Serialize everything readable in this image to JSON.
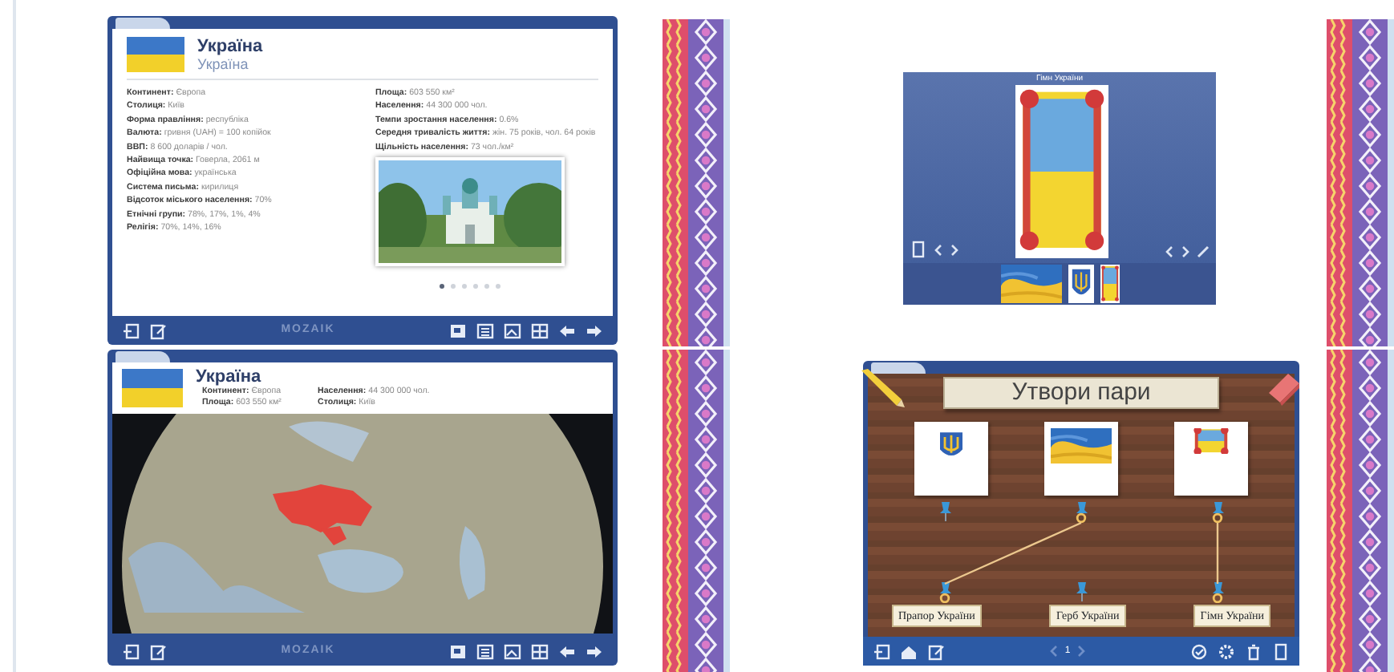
{
  "slides": [
    {
      "kind": "country_card",
      "title": "Україна",
      "subtitle": "Україна",
      "facts_left": [
        "**Континент:** Європа",
        "**Столиця:** Київ",
        "**Форма правління:** республіка",
        "**Валюта:** гривня (UAH) = 100 копійок",
        "**ВВП:** 8 600 доларів / чол.",
        "**Найвища точка:** Говерла, 2061 м",
        "**Офіційна мова:** українська",
        "**Система письма:** кирилиця",
        "**Відсоток міського населення:** 70%",
        "**Етнічні групи:** 78%, 17%, 1%, 4%",
        "**Релігія:** 70%, 14%, 16%"
      ],
      "facts_right": [
        "**Площа:** 603 550 км²",
        "**Населення:** 44 300 000 чол.",
        "**Темпи зростання населення:** 0.6%",
        "**Середня тривалість життя:** жін. 75 років, чол. 64 років",
        "**Щільність населення:** 73 чол./км²"
      ],
      "photo_dots": [
        {
          "selected": true
        },
        {
          "selected": false
        },
        {
          "selected": false
        },
        {
          "selected": false
        },
        {
          "selected": false
        },
        {
          "selected": false
        }
      ],
      "logo": "MOZAIK"
    },
    {
      "kind": "gallery",
      "title": "Гімн України"
    },
    {
      "kind": "map_card",
      "title": "Україна",
      "facts": [
        "**Континент:** Європа",
        "**Населення:** 44 300 000 чол.",
        "**Площа:** 603 550 км²",
        "**Столиця:** Київ"
      ],
      "logo": "MOZAIK"
    },
    {
      "kind": "matching",
      "title": "Утвори пари",
      "cards": [
        {
          "connected": false
        },
        {
          "connected": true
        },
        {
          "connected": true
        }
      ],
      "labels": [
        {
          "text": "Прапор України",
          "connected": true
        },
        {
          "text": "Герб України",
          "connected": false
        },
        {
          "text": "Гімн України",
          "connected": true
        }
      ],
      "page": "1"
    }
  ]
}
